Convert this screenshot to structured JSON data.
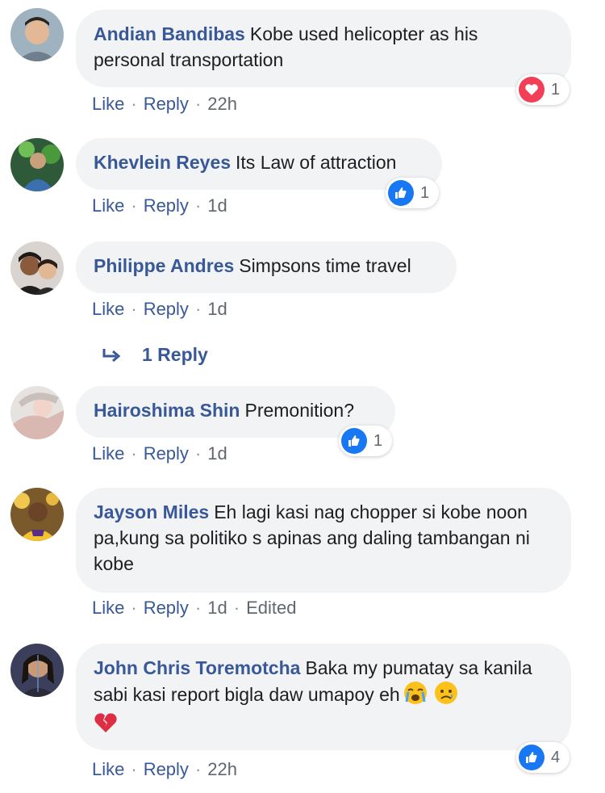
{
  "action_labels": {
    "like": "Like",
    "reply": "Reply",
    "sep": "·"
  },
  "comments": [
    {
      "author": "Andian Bandibas",
      "text": "Kobe used helicopter as his personal transportation",
      "time": "22h",
      "reaction_type": "love",
      "reaction_count": "1"
    },
    {
      "author": "Khevlein Reyes",
      "text": "Its Law of attraction",
      "time": "1d",
      "reaction_type": "like",
      "reaction_count": "1"
    },
    {
      "author": "Philippe Andres",
      "text": "Simpsons time travel",
      "time": "1d"
    },
    {
      "author": "Hairoshima Shin",
      "text": "Premonition?",
      "time": "1d",
      "reaction_type": "like",
      "reaction_count": "1"
    },
    {
      "author": "Jayson Miles",
      "text": "Eh lagi kasi nag chopper si kobe noon pa,kung sa politiko s apinas ang daling tambangan ni kobe",
      "time": "1d",
      "edited": "Edited"
    },
    {
      "author": "John Chris Toremotcha",
      "text": "Baka my pumatay sa kanila sabi kasi report bigla daw umapoy eh",
      "time": "22h",
      "reaction_type": "like",
      "reaction_count": "4",
      "emojis": [
        "crying-face-emoji",
        "sad-face-emoji",
        "broken-heart-emoji"
      ]
    }
  ],
  "view_replies": {
    "label": "1 Reply"
  },
  "colors": {
    "name_blue": "#385898",
    "bubble": "#f2f3f5",
    "like_blue": "#1877f2",
    "love_red": "#f33e58"
  }
}
